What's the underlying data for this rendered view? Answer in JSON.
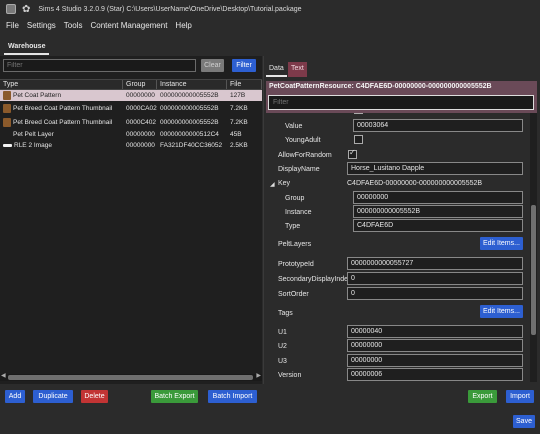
{
  "window": {
    "title": "Sims 4 Studio 3.2.0.9 (Star)  C:\\Users\\UserName\\OneDrive\\Desktop\\Tutorial.package",
    "app_icon": "app-icon",
    "palette_icon": "palette-icon"
  },
  "menu": [
    "File",
    "Settings",
    "Tools",
    "Content Management",
    "Help"
  ],
  "left": {
    "tab": "Warehouse",
    "filter_placeholder": "Filter",
    "clear_label": "Clear",
    "filter_label": "Filter",
    "columns": [
      "Type",
      "Group",
      "Instance",
      "File"
    ],
    "rows": [
      {
        "type": "Pet Coat Pattern",
        "group": "00000000",
        "instance": "000000000005552B",
        "file": "127B",
        "icon": "horse-icon",
        "selected": true
      },
      {
        "type": "Pet Breed Coat Pattern Thumbnail",
        "group": "0000CA02",
        "instance": "000000000005552B",
        "file": "7.2KB",
        "icon": "horse-icon"
      },
      {
        "type": "Pet Breed Coat Pattern Thumbnail",
        "group": "0000C402",
        "instance": "000000000005552B",
        "file": "7.2KB",
        "icon": "horse-icon"
      },
      {
        "type": "Pet Pelt Layer",
        "group": "00000000",
        "instance": "00000000000512C4",
        "file": "45B",
        "icon": "none"
      },
      {
        "type": "RLE 2 Image",
        "group": "00000000",
        "instance": "FA321DF40CC36052",
        "file": "2.5KB",
        "icon": "white-bar-icon"
      }
    ]
  },
  "right": {
    "tabs": [
      "Data",
      "Text"
    ],
    "popup_title": "PetCoatPatternResource: C4DFAE6D-00000000-000000000005552B",
    "popup_filter_placeholder": "Filter",
    "props": {
      "value_label": "Value",
      "value": "00003064",
      "young_adult_label": "YoungAdult",
      "allow_random_label": "AllowForRandom",
      "display_name_label": "DisplayName",
      "display_name": "Horse_Lusitano Dapple",
      "key_label": "Key",
      "key_value": "C4DFAE6D-00000000-000000000005552B",
      "group_label": "Group",
      "group": "00000000",
      "instance_label": "Instance",
      "instance": "000000000005552B",
      "type_label": "Type",
      "type": "C4DFAE6D",
      "pelt_layers_label": "PeltLayers",
      "edit_items_label": "Edit Items...",
      "prototype_label": "PrototypeId",
      "prototype": "0000000000055727",
      "secondary_label": "SecondaryDisplayIndex",
      "secondary": "0",
      "sort_label": "SortOrder",
      "sort": "0",
      "tags_label": "Tags",
      "u1_label": "U1",
      "u1": "00000040",
      "u2_label": "U2",
      "u2": "00000000",
      "u3_label": "U3",
      "u3": "00000000",
      "version_label": "Version",
      "version": "00000006"
    }
  },
  "bottom": {
    "add": "Add",
    "duplicate": "Duplicate",
    "delete": "Delete",
    "batch_export": "Batch Export",
    "batch_import": "Batch Import",
    "export": "Export",
    "import": "Import",
    "save": "Save"
  },
  "colors": {
    "accent_blue": "#2d5fd1",
    "delete_red": "#c23434",
    "export_green": "#3a9a3a",
    "selection": "#d9c7cf"
  }
}
